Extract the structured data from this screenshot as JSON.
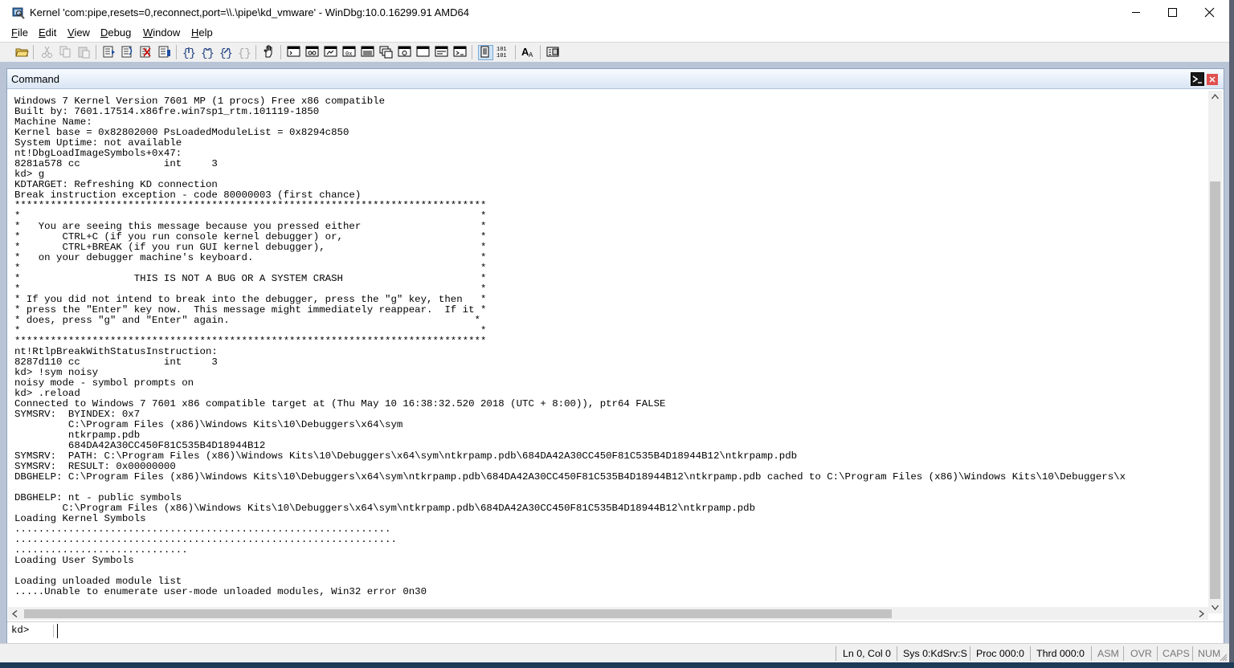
{
  "window": {
    "title": "Kernel 'com:pipe,resets=0,reconnect,port=\\\\.\\pipe\\kd_vmware' - WinDbg:10.0.16299.91 AMD64"
  },
  "menu": {
    "items": [
      {
        "key": "F",
        "rest": "ile"
      },
      {
        "key": "E",
        "rest": "dit"
      },
      {
        "key": "V",
        "rest": "iew"
      },
      {
        "key": "D",
        "rest": "ebug"
      },
      {
        "key": "W",
        "rest": "indow"
      },
      {
        "key": "H",
        "rest": "elp"
      }
    ]
  },
  "toolbar": {
    "buttons": [
      "open-file",
      "cut",
      "copy",
      "paste",
      "step-in",
      "step-over",
      "step-out",
      "run-to-cursor",
      "go",
      "break",
      "restart",
      "stop",
      "hand-source-mode",
      "command-window",
      "watch-window",
      "locals-window",
      "registers-window",
      "memory-window",
      "call-stack-window",
      "disassembly-window",
      "scratch-pad-window",
      "processes-threads-window",
      "source-mode",
      "hex-mode",
      "font",
      "options"
    ]
  },
  "command_window": {
    "title": "Command",
    "output": [
      "Windows 7 Kernel Version 7601 MP (1 procs) Free x86 compatible",
      "Built by: 7601.17514.x86fre.win7sp1_rtm.101119-1850",
      "Machine Name:",
      "Kernel base = 0x82802000 PsLoadedModuleList = 0x8294c850",
      "System Uptime: not available",
      "nt!DbgLoadImageSymbols+0x47:",
      "8281a578 cc              int     3",
      "kd> g",
      "KDTARGET: Refreshing KD connection",
      "Break instruction exception - code 80000003 (first chance)",
      "*******************************************************************************",
      "*                                                                             *",
      "*   You are seeing this message because you pressed either                    *",
      "*       CTRL+C (if you run console kernel debugger) or,                       *",
      "*       CTRL+BREAK (if you run GUI kernel debugger),                          *",
      "*   on your debugger machine's keyboard.                                      *",
      "*                                                                             *",
      "*                   THIS IS NOT A BUG OR A SYSTEM CRASH                       *",
      "*                                                                             *",
      "* If you did not intend to break into the debugger, press the \"g\" key, then   *",
      "* press the \"Enter\" key now.  This message might immediately reappear.  If it *",
      "* does, press \"g\" and \"Enter\" again.                                         *",
      "*                                                                             *",
      "*******************************************************************************",
      "nt!RtlpBreakWithStatusInstruction:",
      "8287d110 cc              int     3",
      "kd> !sym noisy",
      "noisy mode - symbol prompts on",
      "kd> .reload",
      "Connected to Windows 7 7601 x86 compatible target at (Thu May 10 16:38:32.520 2018 (UTC + 8:00)), ptr64 FALSE",
      "SYMSRV:  BYINDEX: 0x7",
      "         C:\\Program Files (x86)\\Windows Kits\\10\\Debuggers\\x64\\sym",
      "         ntkrpamp.pdb",
      "         684DA42A30CC450F81C535B4D18944B12",
      "SYMSRV:  PATH: C:\\Program Files (x86)\\Windows Kits\\10\\Debuggers\\x64\\sym\\ntkrpamp.pdb\\684DA42A30CC450F81C535B4D18944B12\\ntkrpamp.pdb",
      "SYMSRV:  RESULT: 0x00000000",
      "DBGHELP: C:\\Program Files (x86)\\Windows Kits\\10\\Debuggers\\x64\\sym\\ntkrpamp.pdb\\684DA42A30CC450F81C535B4D18944B12\\ntkrpamp.pdb cached to C:\\Program Files (x86)\\Windows Kits\\10\\Debuggers\\x",
      "",
      "DBGHELP: nt - public symbols",
      "        C:\\Program Files (x86)\\Windows Kits\\10\\Debuggers\\x64\\sym\\ntkrpamp.pdb\\684DA42A30CC450F81C535B4D18944B12\\ntkrpamp.pdb",
      "Loading Kernel Symbols",
      "...............................................................",
      "................................................................",
      ".............................",
      "Loading User Symbols",
      "",
      "Loading unloaded module list",
      ".....Unable to enumerate user-mode unloaded modules, Win32 error 0n30"
    ],
    "prompt": "kd>",
    "input_value": ""
  },
  "statusbar": {
    "position": "Ln 0, Col 0",
    "system": "Sys 0:KdSrv:S",
    "process": "Proc 000:0",
    "thread": "Thrd 000:0",
    "asm": "ASM",
    "ovr": "OVR",
    "caps": "CAPS",
    "num": "NUM"
  }
}
